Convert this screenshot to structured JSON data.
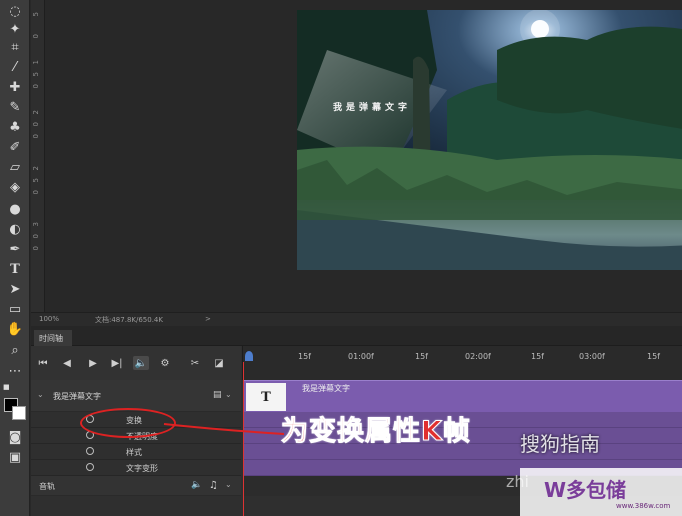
{
  "toolbar": {
    "tools": [
      "lasso",
      "magic-wand",
      "crop",
      "eyedropper",
      "healing",
      "brush",
      "stamp",
      "history-brush",
      "eraser",
      "paint-bucket",
      "blur",
      "dodge",
      "pen",
      "type",
      "path-select",
      "rectangle",
      "hand",
      "zoom",
      "more"
    ]
  },
  "ruler": {
    "labels": [
      "5",
      "0",
      "1",
      "5",
      "0",
      "2",
      "0",
      "0",
      "2",
      "5",
      "0",
      "3",
      "0",
      "0"
    ]
  },
  "canvas": {
    "overlay_text": "我是弹幕文字"
  },
  "status": {
    "zoom": "100%",
    "doc": "文档:487.8K/650.4K",
    "arrow": ">"
  },
  "timeline": {
    "tab_label": "时间轴",
    "ticks": [
      "15f",
      "01:00f",
      "15f",
      "02:00f",
      "15f",
      "03:00f",
      "15f"
    ],
    "layer_name": "我是弹幕文字",
    "clip_label": "我是弹幕文字",
    "clip_thumb": "T",
    "properties": [
      "变换",
      "不透明度",
      "样式",
      "文字变形"
    ],
    "audio_label": "音轨"
  },
  "annotation": {
    "text": "为变换属性K帧"
  },
  "watermarks": {
    "sogou": "搜狗指南",
    "logo": "W多包储",
    "zhi": "zhi",
    "url": "www.386w.com"
  }
}
